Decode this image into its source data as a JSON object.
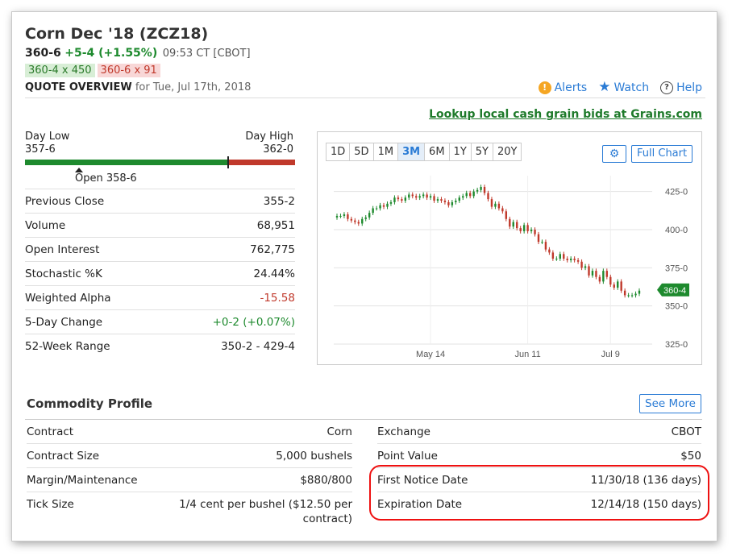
{
  "header": {
    "title": "Corn Dec '18 (ZCZ18)",
    "last": "360-6",
    "change": "+5-4 (+1.55%)",
    "time": "09:53 CT [CBOT]",
    "bid": "360-4 x 450",
    "ask": "360-6 x 91",
    "quote_overview": "QUOTE OVERVIEW",
    "quote_date": "for Tue, Jul 17th, 2018"
  },
  "tools": {
    "alerts": "Alerts",
    "watch": "Watch",
    "help": "Help",
    "alert_icon": "alert-icon",
    "watch_icon": "star-icon",
    "help_icon": "question-icon"
  },
  "lookup_link": "Lookup local cash grain bids at Grains.com",
  "day_range": {
    "low_label": "Day Low",
    "low": "357-6",
    "high_label": "Day High",
    "high": "362-0",
    "open": "Open 358-6"
  },
  "stats": [
    {
      "label": "Previous Close",
      "value": "355-2",
      "tone": ""
    },
    {
      "label": "Volume",
      "value": "68,951",
      "tone": ""
    },
    {
      "label": "Open Interest",
      "value": "762,775",
      "tone": ""
    },
    {
      "label": "Stochastic %K",
      "value": "24.44%",
      "tone": ""
    },
    {
      "label": "Weighted Alpha",
      "value": "-15.58",
      "tone": "neg"
    },
    {
      "label": "5-Day Change",
      "value": "+0-2 (+0.07%)",
      "tone": "pos"
    },
    {
      "label": "52-Week Range",
      "value": "350-2 - 429-4",
      "tone": ""
    }
  ],
  "chart": {
    "periods": [
      "1D",
      "5D",
      "1M",
      "3M",
      "6M",
      "1Y",
      "5Y",
      "20Y"
    ],
    "selected_period": "3M",
    "full_chart": "Full Chart",
    "gear_icon": "gear-icon"
  },
  "chart_data": {
    "type": "candlestick",
    "y_ticks": [
      "425-0",
      "400-0",
      "375-0",
      "350-0",
      "325-0"
    ],
    "x_ticks": [
      "May 14",
      "Jun 11",
      "Jul 9"
    ],
    "ylim": [
      325,
      437.5
    ],
    "last_label": "360-4",
    "up_color": "#1e8a2e",
    "down_color": "#c0392b",
    "closes": [
      409,
      409,
      410,
      407,
      406,
      405,
      404,
      407,
      408,
      411,
      414,
      414,
      416,
      415,
      417,
      418,
      421,
      420,
      419,
      421,
      423,
      422,
      421,
      422,
      423,
      421,
      422,
      419,
      420,
      419,
      418,
      416,
      418,
      419,
      421,
      422,
      424,
      422,
      425,
      426,
      428,
      424,
      420,
      415,
      417,
      414,
      412,
      407,
      402,
      405,
      401,
      399,
      403,
      399,
      400,
      397,
      392,
      392,
      387,
      385,
      381,
      381,
      384,
      381,
      380,
      381,
      380,
      379,
      375,
      376,
      370,
      373,
      369,
      366,
      373,
      369,
      364,
      362,
      366,
      360,
      357,
      357,
      357,
      358,
      360
    ]
  },
  "profile": {
    "title": "Commodity Profile",
    "see_more": "See More",
    "left": [
      {
        "label": "Contract",
        "value": "Corn"
      },
      {
        "label": "Contract Size",
        "value": "5,000 bushels"
      },
      {
        "label": "Margin/Maintenance",
        "value": "$880/800"
      },
      {
        "label": "Tick Size",
        "value": "1/4 cent per bushel ($12.50 per contract)"
      }
    ],
    "right": [
      {
        "label": "Exchange",
        "value": "CBOT"
      },
      {
        "label": "Point Value",
        "value": "$50"
      },
      {
        "label": "First Notice Date",
        "value": "11/30/18 (136 days)"
      },
      {
        "label": "Expiration Date",
        "value": "12/14/18 (150 days)"
      }
    ]
  }
}
